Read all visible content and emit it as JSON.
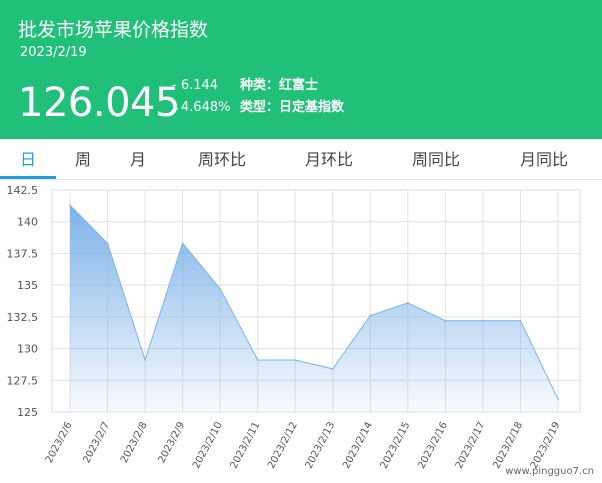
{
  "header": {
    "title": "批发市场苹果价格指数",
    "date": "2023/2/19",
    "price": "126.045",
    "change": "- 6.144",
    "change_pct": "↓4.648%",
    "variety": "种类：红富士",
    "index_type": "类型：日定基指数"
  },
  "tabs": [
    {
      "label": "日",
      "active": true
    },
    {
      "label": "周",
      "active": false
    },
    {
      "label": "月",
      "active": false
    },
    {
      "label": "周环比",
      "active": false
    },
    {
      "label": "月环比",
      "active": false
    },
    {
      "label": "周同比",
      "active": false
    },
    {
      "label": "月同比",
      "active": false
    }
  ],
  "watermark": "www.pingguo7.cn",
  "colors": {
    "header_bg": "#21c07a",
    "tab_active": "#1e9fe0",
    "series_line": "#7cb3ea",
    "series_fill_top": "#76aee8"
  },
  "chart_data": {
    "type": "area",
    "x": [
      "2023/2/6",
      "2023/2/7",
      "2023/2/8",
      "2023/2/9",
      "2023/2/10",
      "2023/2/11",
      "2023/2/12",
      "2023/2/13",
      "2023/2/14",
      "2023/2/15",
      "2023/2/16",
      "2023/2/17",
      "2023/2/18",
      "2023/2/19"
    ],
    "values": [
      141.3,
      138.3,
      129.1,
      138.3,
      134.7,
      129.1,
      129.1,
      128.4,
      132.6,
      133.6,
      132.2,
      132.2,
      132.2,
      126.0
    ],
    "yticks": [
      "142.5",
      "140",
      "137.5",
      "135",
      "132.5",
      "130",
      "127.5",
      "125"
    ],
    "ylim": [
      125,
      142.5
    ],
    "grid": true
  }
}
